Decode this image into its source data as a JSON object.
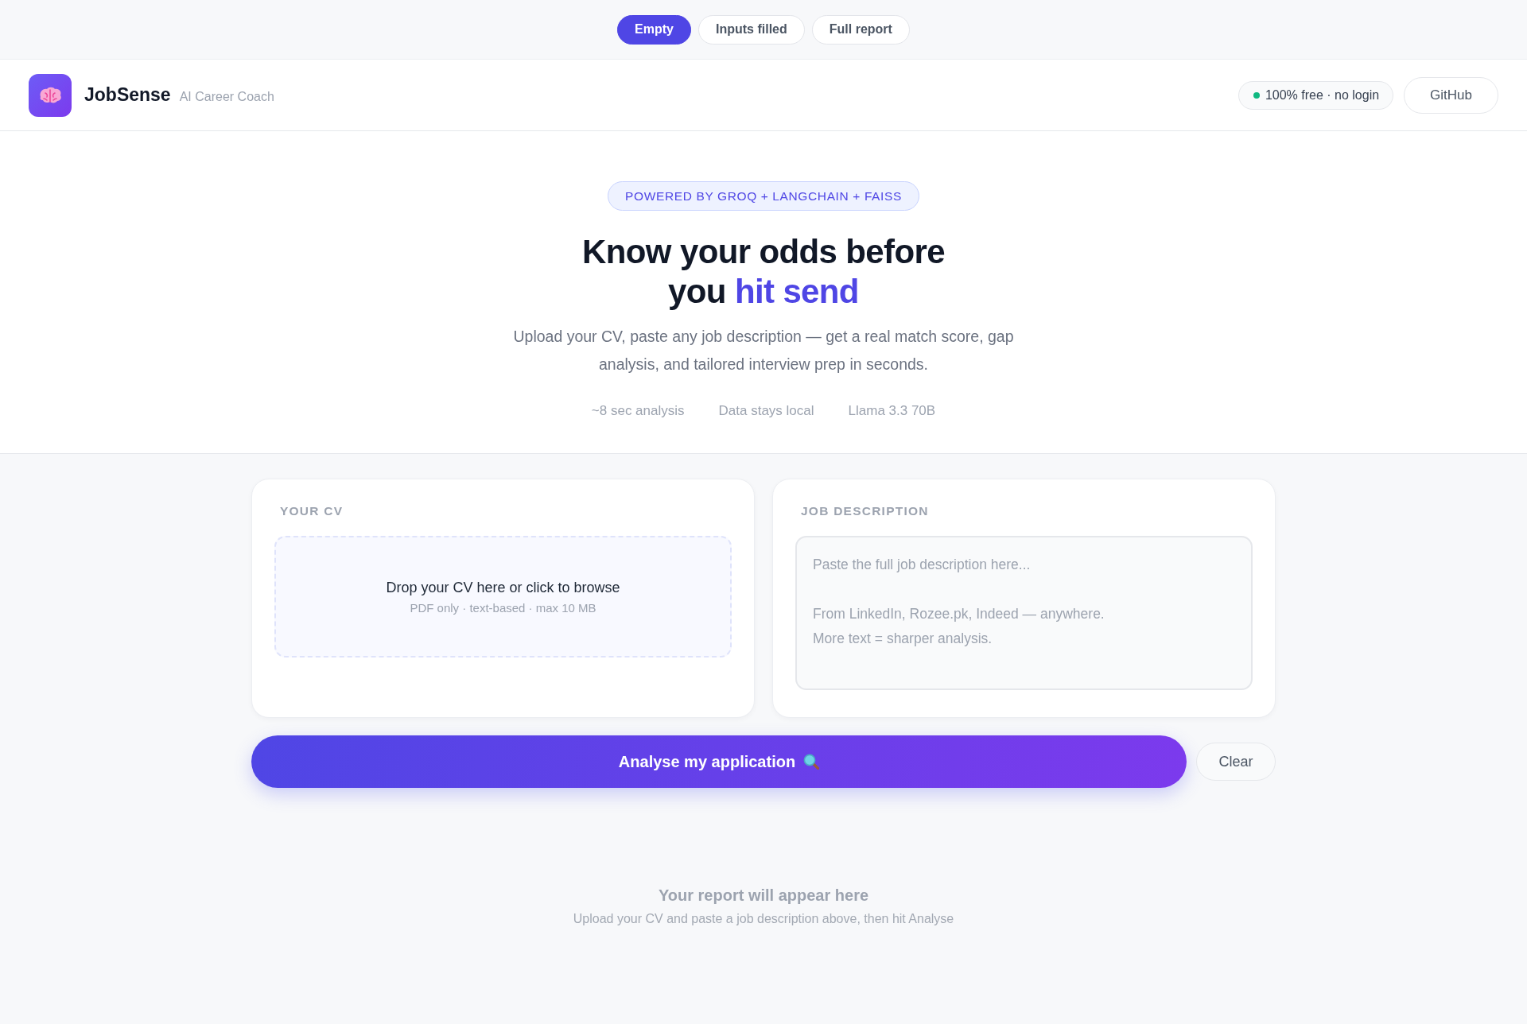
{
  "demo_tabs": [
    {
      "label": "Empty",
      "selected": true
    },
    {
      "label": "Inputs filled",
      "selected": false
    },
    {
      "label": "Full report",
      "selected": false
    }
  ],
  "header": {
    "brand": "JobSense",
    "tagline": "AI Career Coach",
    "status_pill": "100% free · no login",
    "github_button": "GitHub"
  },
  "hero": {
    "badge": "POWERED BY GROQ + LANGCHAIN + FAISS",
    "headline": "Know your odds before you",
    "headline_highlight": "hit send",
    "subtitle": "Upload your CV, paste any job description — get a real match score, gap analysis, and tailored interview prep in seconds.",
    "stats": [
      "~8 sec analysis",
      "Data stays local",
      "Llama 3.3 70B"
    ]
  },
  "cv_card": {
    "label": "YOUR CV",
    "dropzone_title": "Drop your CV here or click to browse",
    "dropzone_hint": "PDF only · text-based · max 10 MB"
  },
  "job_card": {
    "label": "JOB DESCRIPTION",
    "placeholder": "Paste the full job description here...\n\nFrom LinkedIn, Rozee.pk, Indeed — anywhere.\nMore text = sharper analysis."
  },
  "analyse_button": "Analyse my application",
  "clear_button": "Clear",
  "empty_state": {
    "title": "Your report will appear here",
    "hint": "Upload your CV and paste a job description above, then hit Analyse"
  }
}
